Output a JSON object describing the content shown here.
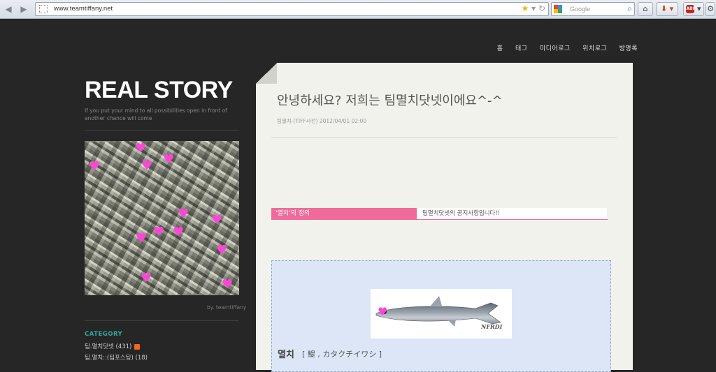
{
  "browser": {
    "url": "www.teamtiffany.net",
    "search_placeholder": "Google"
  },
  "nav": [
    "홈",
    "태그",
    "미디어로그",
    "위치로그",
    "방명록"
  ],
  "blog": {
    "title": "REAL STORY",
    "subtitle": "If you put your mind to all possibilities open in front of another chance will come",
    "byline": "by. teamtiffany"
  },
  "sidebar": {
    "category_heading": "CATEGORY",
    "categories": [
      {
        "label": "팀.멸치닷넷 (431)"
      },
      {
        "label": "팀.멸치::(팀포스팅) (18)"
      }
    ]
  },
  "post": {
    "title": "안녕하세요? 저희는 팀멸치닷넷이에요^-^",
    "meta": "팀멸치-(TIFF사전) 2012/04/01 02:00",
    "notice_label": "'멸치'의 정의",
    "notice_text": "팀멸치닷넷의 공지사항입니다!!",
    "fish_caption": "NFRDI",
    "definition_word": "멸치",
    "definition_rest": "[ 鯷 , カタクチイワシ ]"
  },
  "colors": {
    "background": "#262626",
    "accent_pink": "#f06a9a",
    "category_teal": "#36a6a0",
    "heart": "#ff45d8"
  }
}
